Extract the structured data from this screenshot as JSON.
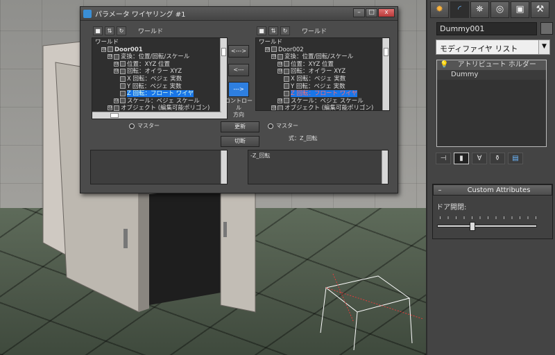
{
  "dialog": {
    "title": "パラメータ ワイヤリング #1",
    "window_buttons": [
      "–",
      "□",
      "x"
    ],
    "left_toolbar_label": "ワールド",
    "right_toolbar_label": "ワールド",
    "left_tree": [
      {
        "text": "ワールド",
        "indent": 0,
        "type": "root"
      },
      {
        "text": "Door001",
        "indent": 1,
        "type": "object",
        "bold": true
      },
      {
        "text": "変換：位置/回転/スケール",
        "indent": 2,
        "type": "node"
      },
      {
        "text": "位置：XYZ 位置",
        "indent": 3,
        "type": "node"
      },
      {
        "text": "回転：オイラー XYZ",
        "indent": 3,
        "type": "node"
      },
      {
        "text": "X 回転：ベジェ 実数",
        "indent": 4,
        "type": "leaf"
      },
      {
        "text": "Y 回転：ベジェ 実数",
        "indent": 4,
        "type": "leaf"
      },
      {
        "text": "Z 回転：フロート ワイヤ",
        "indent": 4,
        "type": "leaf",
        "selected": true
      },
      {
        "text": "スケール：ベジェ スケール",
        "indent": 3,
        "type": "node"
      },
      {
        "text": "オブジェクト (編集可能ポリゴン)",
        "indent": 2,
        "type": "node"
      }
    ],
    "right_tree": [
      {
        "text": "ワールド",
        "indent": 0,
        "type": "root"
      },
      {
        "text": "Door002",
        "indent": 1,
        "type": "object"
      },
      {
        "text": "変換：位置/回転/スケール",
        "indent": 2,
        "type": "node"
      },
      {
        "text": "位置：XYZ 位置",
        "indent": 3,
        "type": "node"
      },
      {
        "text": "回転：オイラー XYZ",
        "indent": 3,
        "type": "node"
      },
      {
        "text": "X 回転：ベジェ 実数",
        "indent": 4,
        "type": "leaf"
      },
      {
        "text": "Y 回転：ベジェ 実数",
        "indent": 4,
        "type": "leaf"
      },
      {
        "text": "Z 回転：フロート ワイヤ",
        "indent": 4,
        "type": "leaf",
        "selected": true
      },
      {
        "text": "スケール：ベジェ スケール",
        "indent": 3,
        "type": "node"
      },
      {
        "text": "オブジェクト (編集可能ポリゴン)",
        "indent": 2,
        "type": "node"
      }
    ],
    "arrow_both": "<--->",
    "arrow_left": "<---",
    "arrow_right": "--->",
    "control_direction": "コントロール\n方向",
    "master_left": "マスター",
    "master_right": "マスター",
    "update_label": "更新",
    "disconnect_label": "切断",
    "expression_label": "式：Z_回転",
    "left_expression": "",
    "right_expression": "-Z_回転"
  },
  "panel": {
    "tabs": [
      "create-tab",
      "modify-tab",
      "hierarchy-tab",
      "motion-tab",
      "display-tab",
      "utilities-tab"
    ],
    "object_name": "Dummy001",
    "object_color": "#6b6b6b",
    "modifier_list_label": "モディファイヤ リスト",
    "stack": [
      {
        "text": "アトリビュート ホルダー",
        "type": "modifier"
      },
      {
        "text": "Dummy",
        "type": "base"
      }
    ],
    "rollout_title": "Custom Attributes",
    "rollout_toggle": "–",
    "slider_label": "ドア開閉:",
    "slider_fraction": 0.34
  }
}
